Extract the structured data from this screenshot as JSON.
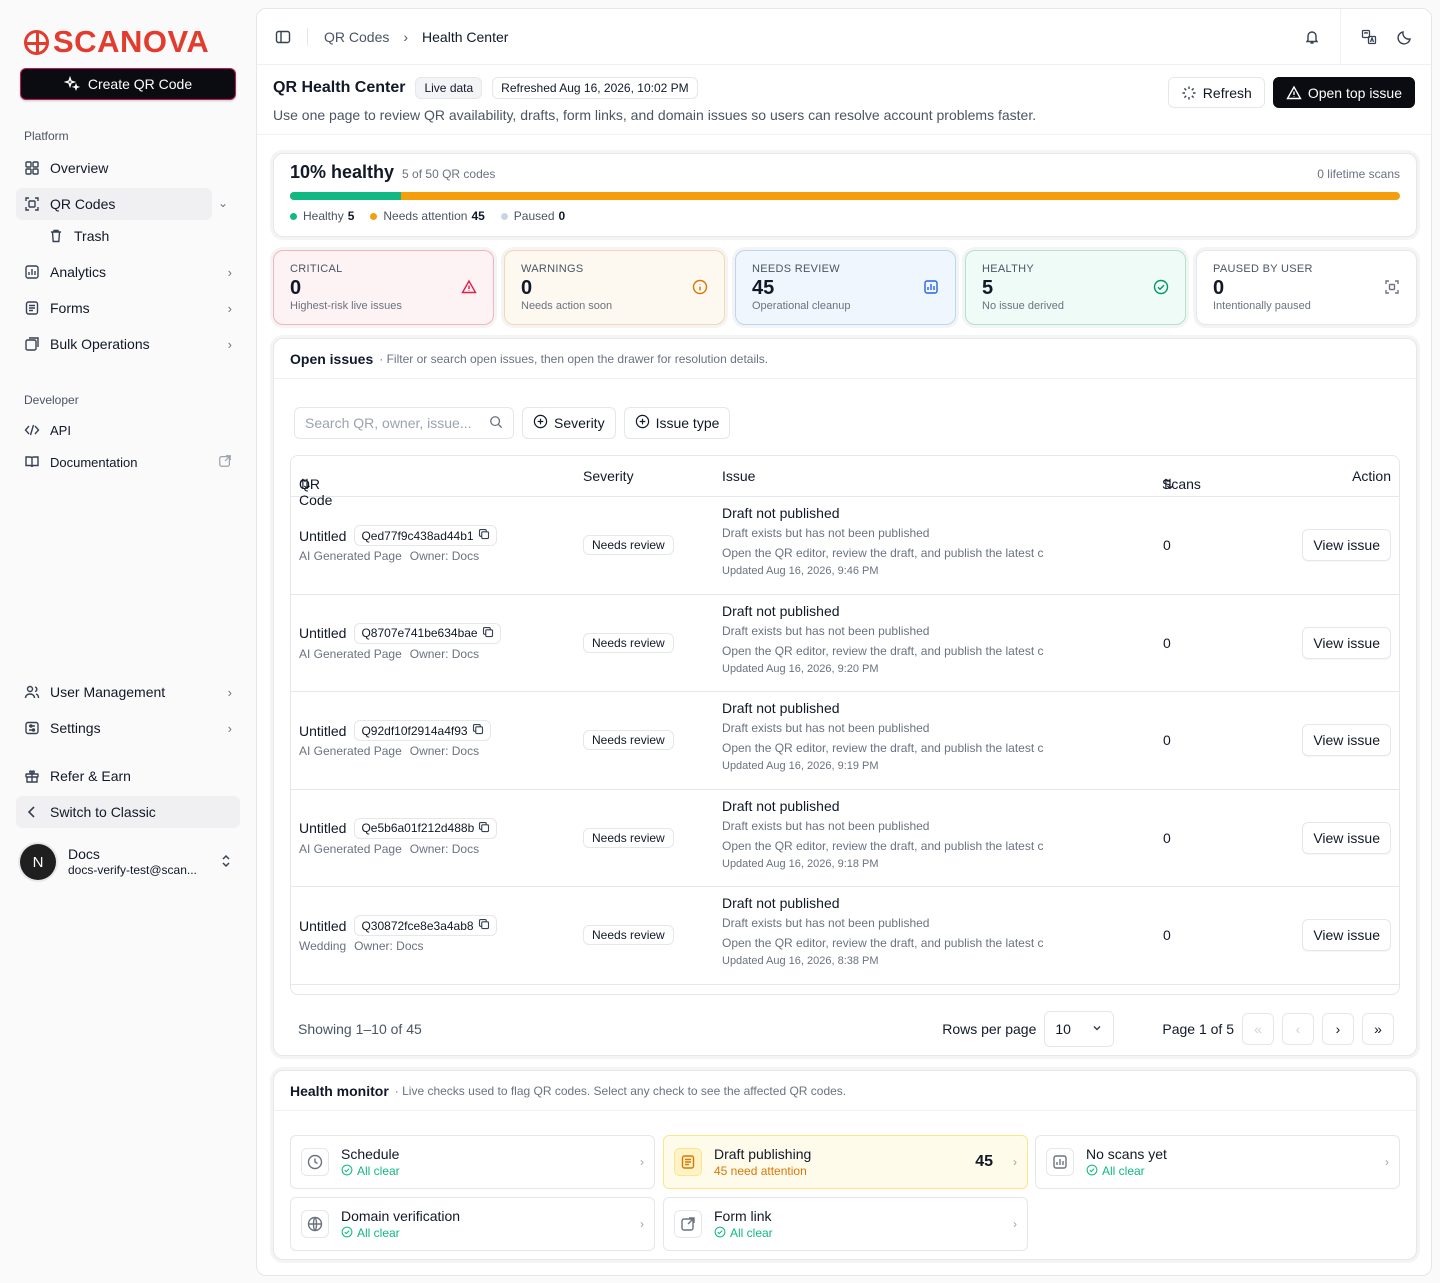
{
  "brand": {
    "name": "SCANOVA",
    "color": "#e23c2e"
  },
  "sidebar": {
    "create_label": "Create QR Code",
    "platform_label": "Platform",
    "developer_label": "Developer",
    "items": {
      "overview": "Overview",
      "qr_codes": "QR Codes",
      "trash": "Trash",
      "analytics": "Analytics",
      "forms": "Forms",
      "bulk": "Bulk Operations",
      "api": "API",
      "docs": "Documentation",
      "users": "User Management",
      "settings": "Settings",
      "refer": "Refer & Earn",
      "classic": "Switch to Classic"
    },
    "user": {
      "initial": "N",
      "name": "Docs",
      "email": "docs-verify-test@scan..."
    }
  },
  "breadcrumb": {
    "parent": "QR Codes",
    "current": "Health Center"
  },
  "header": {
    "title": "QR Health Center",
    "live": "Live data",
    "refreshed": "Refreshed Aug 16, 2026, 10:02 PM",
    "subtitle": "Use one page to review QR availability, drafts, form links, and domain issues so users can resolve account problems faster.",
    "refresh_label": "Refresh",
    "open_top_label": "Open top issue"
  },
  "health": {
    "percent_label": "10% healthy",
    "count_label": "5 of 50 QR codes",
    "lifetime": "0 lifetime scans",
    "healthy_fraction": 0.1,
    "legend": [
      {
        "label": "Healthy",
        "value": "5",
        "color": "#10b981"
      },
      {
        "label": "Needs attention",
        "value": "45",
        "color": "#f59e0b"
      },
      {
        "label": "Paused",
        "value": "0",
        "color": "#cbd5e1"
      }
    ]
  },
  "stats": [
    {
      "label": "CRITICAL",
      "value": "0",
      "desc": "Highest-risk live issues",
      "bg": "#fdf2f4",
      "border": "#f3b4bf",
      "icon": "alert-triangle-icon",
      "icolor": "#e11d48"
    },
    {
      "label": "WARNINGS",
      "value": "0",
      "desc": "Needs action soon",
      "bg": "#fdf8f0",
      "border": "#f5d9b0",
      "icon": "info-circle-icon",
      "icolor": "#d97706"
    },
    {
      "label": "NEEDS REVIEW",
      "value": "45",
      "desc": "Operational cleanup",
      "bg": "#eff6fd",
      "border": "#b9d8f3",
      "icon": "chart-icon",
      "icolor": "#2563eb"
    },
    {
      "label": "HEALTHY",
      "value": "5",
      "desc": "No issue derived",
      "bg": "#effbf6",
      "border": "#b1e3cd",
      "icon": "check-circle-icon",
      "icolor": "#059669"
    },
    {
      "label": "PAUSED BY USER",
      "value": "0",
      "desc": "Intentionally paused",
      "bg": "#ffffff",
      "border": "#e5e7eb",
      "icon": "scan-icon",
      "icolor": "#6b7280"
    }
  ],
  "issues": {
    "title": "Open issues",
    "desc": "· Filter or search open issues, then open the drawer for resolution details.",
    "search_placeholder": "Search QR, owner, issue...",
    "severity_filter": "Severity",
    "type_filter": "Issue type",
    "columns": {
      "qr": "QR Code",
      "severity": "Severity",
      "issue": "Issue",
      "scans": "Scans",
      "action": "Action"
    },
    "rows": [
      {
        "name": "Untitled",
        "code": "Qed77f9c438ad44b1",
        "type": "AI Generated Page",
        "owner": "Owner: Docs",
        "severity": "Needs review",
        "issue": "Draft not published",
        "detail": "Draft exists but has not been published",
        "fix": "Open the QR editor, review the draft, and publish the latest c",
        "updated": "Updated Aug 16, 2026, 9:46 PM",
        "scans": "0",
        "action": "View issue"
      },
      {
        "name": "Untitled",
        "code": "Q8707e741be634bae",
        "type": "AI Generated Page",
        "owner": "Owner: Docs",
        "severity": "Needs review",
        "issue": "Draft not published",
        "detail": "Draft exists but has not been published",
        "fix": "Open the QR editor, review the draft, and publish the latest c",
        "updated": "Updated Aug 16, 2026, 9:20 PM",
        "scans": "0",
        "action": "View issue"
      },
      {
        "name": "Untitled",
        "code": "Q92df10f2914a4f93",
        "type": "AI Generated Page",
        "owner": "Owner: Docs",
        "severity": "Needs review",
        "issue": "Draft not published",
        "detail": "Draft exists but has not been published",
        "fix": "Open the QR editor, review the draft, and publish the latest c",
        "updated": "Updated Aug 16, 2026, 9:19 PM",
        "scans": "0",
        "action": "View issue"
      },
      {
        "name": "Untitled",
        "code": "Qe5b6a01f212d488b",
        "type": "AI Generated Page",
        "owner": "Owner: Docs",
        "severity": "Needs review",
        "issue": "Draft not published",
        "detail": "Draft exists but has not been published",
        "fix": "Open the QR editor, review the draft, and publish the latest c",
        "updated": "Updated Aug 16, 2026, 9:18 PM",
        "scans": "0",
        "action": "View issue"
      },
      {
        "name": "Untitled",
        "code": "Q30872fce8e3a4ab8",
        "type": "Wedding",
        "owner": "Owner: Docs",
        "severity": "Needs review",
        "issue": "Draft not published",
        "detail": "Draft exists but has not been published",
        "fix": "Open the QR editor, review the draft, and publish the latest c",
        "updated": "Updated Aug 16, 2026, 8:38 PM",
        "scans": "0",
        "action": "View issue"
      }
    ],
    "pager": {
      "showing": "Showing 1–10 of 45",
      "rows_label": "Rows per page",
      "rows_value": "10",
      "page_label": "Page 1 of 5"
    }
  },
  "monitor": {
    "title": "Health monitor",
    "desc": "· Live checks used to flag QR codes. Select any check to see the affected QR codes.",
    "checks": [
      {
        "name": "Schedule",
        "status": "All clear",
        "icon": "clock-icon"
      },
      {
        "name": "Draft publishing",
        "status": "45 need attention",
        "count": "45",
        "icon": "draft-icon"
      },
      {
        "name": "No scans yet",
        "status": "All clear",
        "icon": "chart-icon"
      },
      {
        "name": "Domain verification",
        "status": "All clear",
        "icon": "globe-icon"
      },
      {
        "name": "Form link",
        "status": "All clear",
        "icon": "external-link-icon"
      }
    ]
  }
}
